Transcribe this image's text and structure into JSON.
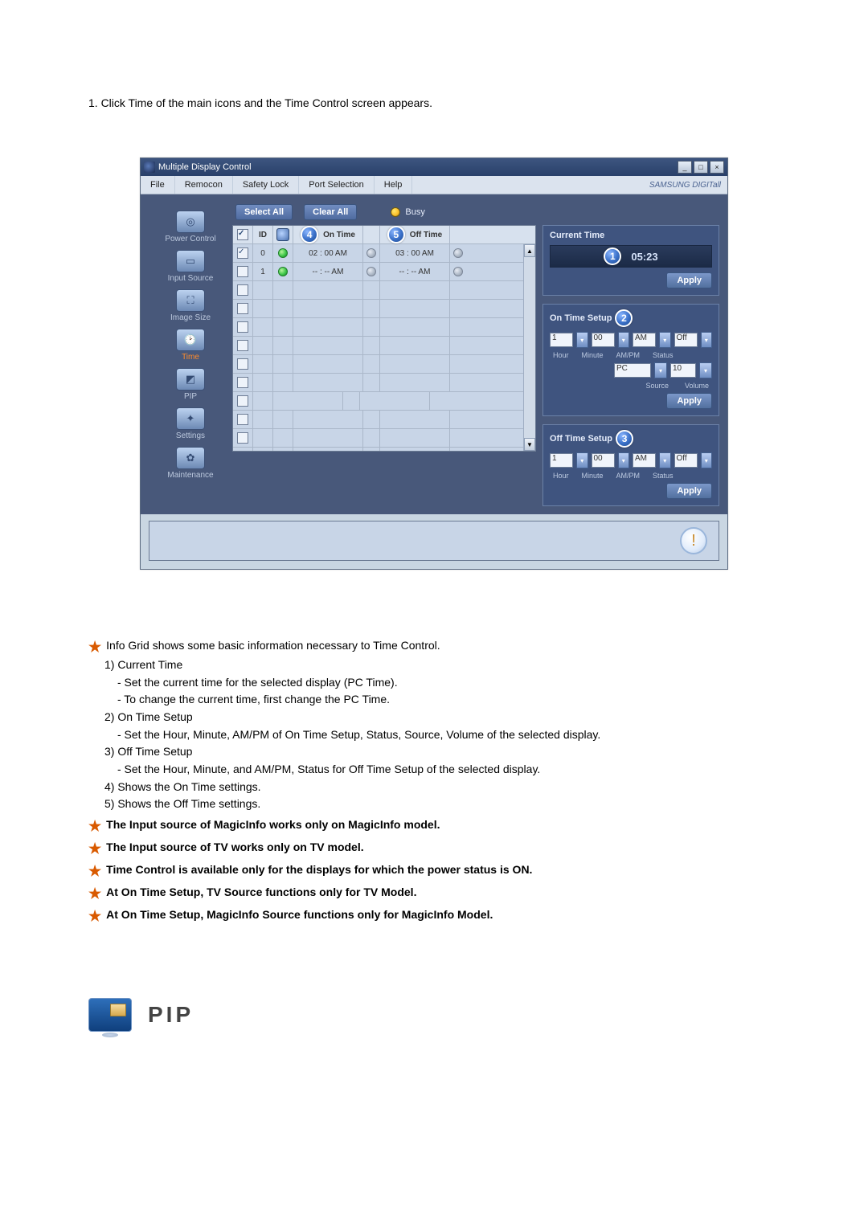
{
  "intro": "1.  Click Time of the main icons and the Time Control screen appears.",
  "window": {
    "title": "Multiple Display Control",
    "minimize": "_",
    "maximize": "□",
    "close": "×"
  },
  "menu": {
    "file": "File",
    "remocon": "Remocon",
    "safety": "Safety Lock",
    "port": "Port Selection",
    "help": "Help",
    "brand": "SAMSUNG DIGITall"
  },
  "sidebar": {
    "power": "Power Control",
    "input": "Input Source",
    "image": "Image Size",
    "time": "Time",
    "pip": "PIP",
    "settings": "Settings",
    "maintenance": "Maintenance"
  },
  "buttons": {
    "selectAll": "Select All",
    "clearAll": "Clear All",
    "busy": "Busy",
    "apply": "Apply"
  },
  "grid": {
    "headers": {
      "id": "ID",
      "onTime": "On Time",
      "offTime": "Off Time"
    },
    "rows": [
      {
        "id": "0",
        "checked": true,
        "ontime": "02 : 00 AM",
        "offtime": "03 : 00 AM",
        "status": "green"
      },
      {
        "id": "1",
        "checked": false,
        "ontime": "-- : -- AM",
        "offtime": "-- : -- AM",
        "status": "green"
      }
    ]
  },
  "right": {
    "currentTime": {
      "title": "Current Time",
      "value": "05:23"
    },
    "onTime": {
      "title": "On Time Setup",
      "hour": "1",
      "minute": "00",
      "ampm": "AM",
      "status": "Off",
      "source": "PC",
      "volume": "10",
      "labels": {
        "hour": "Hour",
        "minute": "Minute",
        "ampm": "AM/PM",
        "status": "Status",
        "source": "Source",
        "volume": "Volume"
      }
    },
    "offTime": {
      "title": "Off Time Setup",
      "hour": "1",
      "minute": "00",
      "ampm": "AM",
      "status": "Off",
      "labels": {
        "hour": "Hour",
        "minute": "Minute",
        "ampm": "AM/PM",
        "status": "Status"
      }
    }
  },
  "badges": {
    "b1": "1",
    "b2": "2",
    "b3": "3",
    "b4": "4",
    "b5": "5"
  },
  "notes": {
    "n0": "Info Grid shows some basic information necessary to Time Control.",
    "i1": "1)  Current Time",
    "i1a": "- Set the current time for the selected display (PC Time).",
    "i1b": "- To change the current time, first change the PC Time.",
    "i2": "2)  On Time Setup",
    "i2a": "- Set the Hour, Minute, AM/PM of On Time Setup, Status, Source, Volume of the selected display.",
    "i3": "3)  Off Time Setup",
    "i3a": "- Set the Hour, Minute, and AM/PM, Status for Off Time Setup of the selected display.",
    "i4": "4)  Shows the On Time settings.",
    "i5": "5)  Shows the Off Time settings.",
    "s1": "The Input source of MagicInfo works only on MagicInfo model.",
    "s2": "The Input source of TV works only on TV model.",
    "s3": "Time Control is available only for the displays for which the power status is ON.",
    "s4": "At On Time Setup, TV Source functions only for TV Model.",
    "s5": "At On Time Setup, MagicInfo Source functions only for MagicInfo Model."
  },
  "pip": {
    "title": "PIP"
  }
}
